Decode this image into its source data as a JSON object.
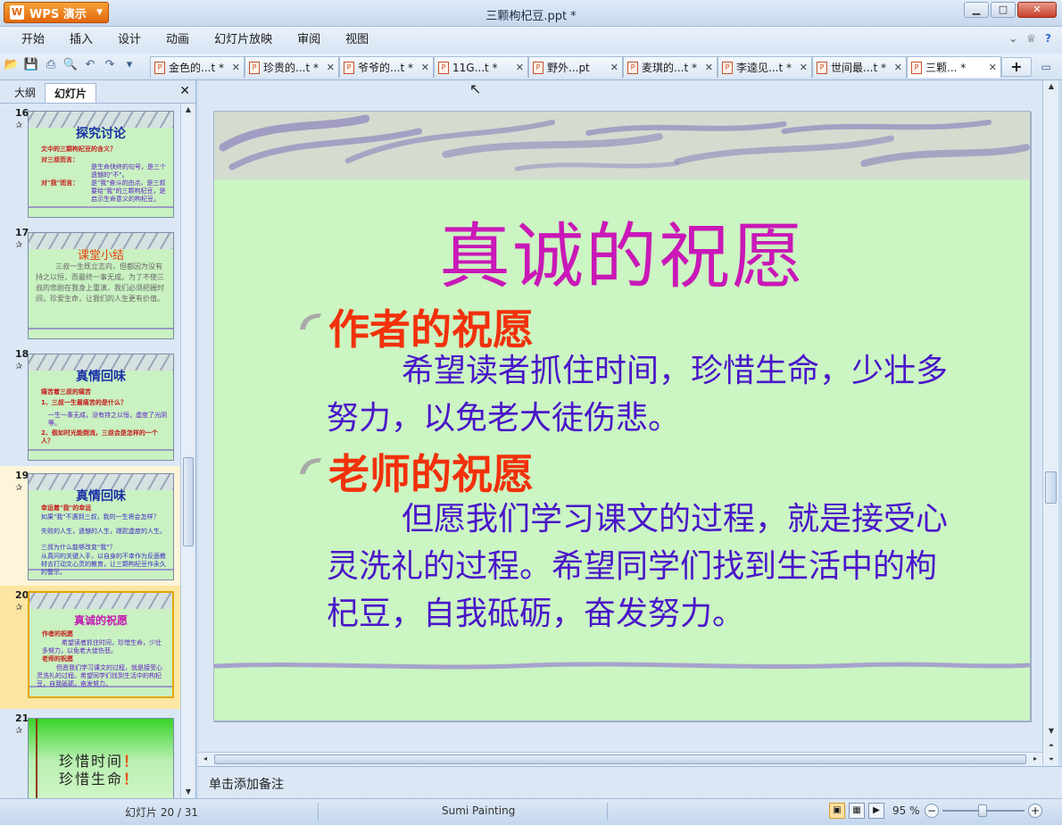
{
  "app": {
    "button_label": "WPS 演示",
    "logo_glyph": "W",
    "window_title": "三颗枸杞豆.ppt *"
  },
  "window_controls": {
    "minimize": "▁",
    "maximize": "□",
    "close": "✕"
  },
  "menu": {
    "items": [
      "开始",
      "插入",
      "设计",
      "动画",
      "幻灯片放映",
      "审阅",
      "视图"
    ]
  },
  "menu_right": {
    "collapse": "⌄",
    "skin": "♕",
    "help": "?"
  },
  "toolbar_icons": [
    "open-icon",
    "save-icon",
    "print-icon",
    "print-preview-icon",
    "undo-icon",
    "redo-icon",
    "customize-icon"
  ],
  "doc_tabs": [
    {
      "label": "金色的...t *",
      "active": false
    },
    {
      "label": "珍贵的...t *",
      "active": false
    },
    {
      "label": "爷爷的...t *",
      "active": false
    },
    {
      "label": "11G...t *",
      "active": false
    },
    {
      "label": "野外...pt",
      "active": false
    },
    {
      "label": "麦琪的...t *",
      "active": false
    },
    {
      "label": "李逵见...t *",
      "active": false
    },
    {
      "label": "世间最...t *",
      "active": false
    },
    {
      "label": "三颗... *",
      "active": true
    }
  ],
  "left_panel": {
    "tab_outline": "大纲",
    "tab_slides": "幻灯片",
    "close": "✕"
  },
  "thumbnails": {
    "t16": {
      "num": "16",
      "title": "探究讨论",
      "lines": [
        "文中的三颗枸杞豆的含义？",
        "对三叔而言：",
        "是生命快终的句号，是三个遗憾的\"不\"。",
        "对\"我\"而言：",
        "是\"我\"奋斗的由点，是三叔要给\"我\"的三颗枸杞豆，是启示生命意义的枸杞豆。"
      ]
    },
    "t17": {
      "num": "17",
      "title": "课堂小结",
      "body": "三叔一生既立志向，但都因为没有持之以恒，而最终一事无成。为了不使三叔的悲剧在我身上重演，我们必须把握时间，珍爱生命，让我们的人生更有价值。"
    },
    "t18": {
      "num": "18",
      "title": "真情回味",
      "lines": [
        "痛苦着三叔的痛苦",
        "1、三叔一生最痛苦的是什么？",
        "一生一事无成，没有持之以恒，虚度了光阴等。",
        "2、假如时光能倒流，三叔会是怎样的一个人？"
      ]
    },
    "t19": {
      "num": "19",
      "title": "真情回味",
      "lines": [
        "幸运着\"我\"的幸运",
        "如果\"我\"不遇到三叔，我的一生将会怎样？",
        "失败的人生，遗憾的人生，蹉跎虚度的人生。",
        "三叔为什么能够改变\"我\"？",
        "从真问的关键入手，以自身的不幸作为反面教材去打动文心灵的教育，让三颗枸杞豆作永久的警示。"
      ]
    },
    "t20": {
      "num": "20",
      "title": "真诚的祝愿",
      "lines": [
        "作者的祝愿",
        "希望读者抓住时间，珍惜生命，少壮多努力，以免老大徒伤悲。",
        "老师的祝愿",
        "但愿我们学习课文的过程，就是接受心灵洗礼的过程。希望同学们找到生活中的枸杞豆，自我砥砺，奋发努力。"
      ]
    },
    "t21": {
      "num": "21",
      "line1": "珍惜时间",
      "line2": "珍惜生命",
      "mark": "！"
    },
    "star": "✰"
  },
  "slide": {
    "title": "真诚的祝愿",
    "heading1": "作者的祝愿",
    "para1": "希望读者抓住时间，珍惜生命，少壮多努力，以免老大徒伤悲。",
    "heading2": "老师的祝愿",
    "para2": "但愿我们学习课文的过程，就是接受心灵洗礼的过程。希望同学们找到生活中的枸杞豆，自我砥砺，奋发努力。",
    "colors": {
      "background": "#cbf5c2",
      "title": "#c918b7",
      "heading": "#f2310c",
      "body": "#4a16c9"
    }
  },
  "notes": {
    "placeholder": "单击添加备注"
  },
  "status": {
    "slide_indicator": "幻灯片 20 / 31",
    "theme": "Sumi Painting",
    "zoom": "95 %"
  }
}
